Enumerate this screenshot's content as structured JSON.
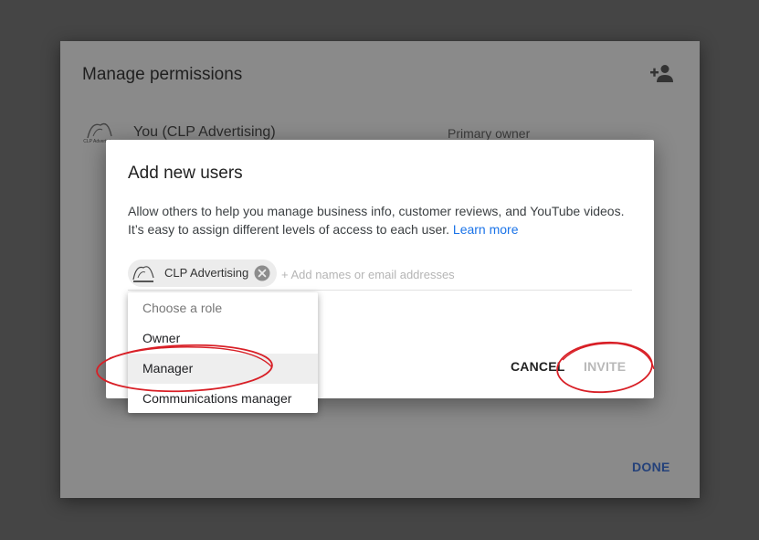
{
  "manage_dialog": {
    "title": "Manage permissions",
    "add_user_icon": "person-add-icon",
    "owner": {
      "name": "You (CLP Advertising)",
      "role": "Primary owner",
      "logo_text": "CLP Advertising"
    },
    "done_label": "DONE"
  },
  "add_users_dialog": {
    "title": "Add new users",
    "description_line1": "Allow others to help you manage business info, customer reviews, and YouTube videos.",
    "description_line2": "It’s easy to assign different levels of access to each user.",
    "learn_more": "Learn more",
    "chip_label": "CLP Advertising",
    "chip_remove_icon": "cancel-icon",
    "input_placeholder": "+ Add names or email addresses",
    "cancel_label": "CANCEL",
    "invite_label": "INVITE"
  },
  "role_menu": {
    "header": "Choose a role",
    "options": [
      "Owner",
      "Manager",
      "Communications manager"
    ],
    "highlighted": "Manager"
  },
  "annotations": {
    "color": "#d81f26",
    "shape": "hand-drawn ellipse"
  }
}
